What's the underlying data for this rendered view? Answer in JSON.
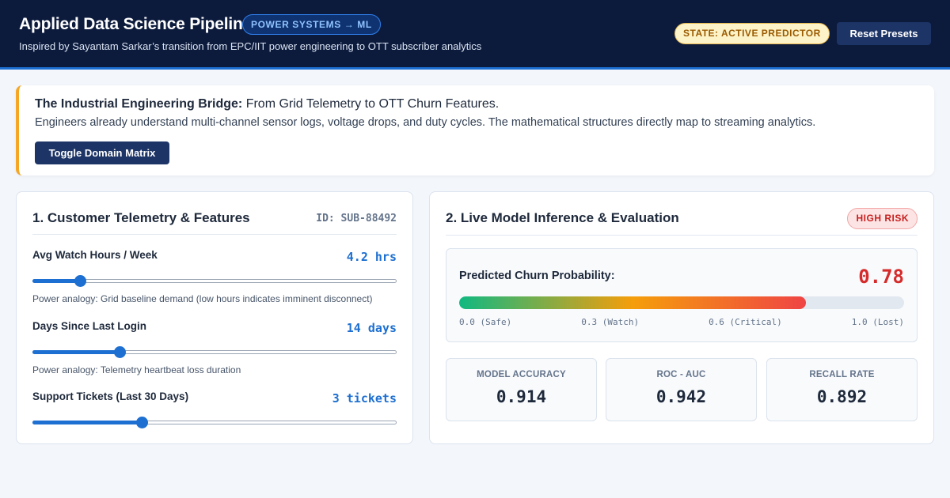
{
  "header": {
    "title": "Applied Data Science Pipeline",
    "badge": "POWER SYSTEMS → ML",
    "subtitle": "Inspired by Sayantam Sarkar’s transition from EPC/IIT power engineering to OTT subscriber analytics",
    "state": "STATE: ACTIVE PREDICTOR",
    "reset_label": "Reset Presets"
  },
  "bridge": {
    "heading_bold": "The Industrial Engineering Bridge:",
    "heading_rest": " From Grid Telemetry to OTT Churn Features.",
    "description": "Engineers already understand multi-channel sensor logs, voltage drops, and duty cycles. The mathematical structures directly map to streaming analytics.",
    "toggle_label": "Toggle Domain Matrix"
  },
  "features_panel": {
    "title": "1. Customer Telemetry & Features",
    "subscriber_id": "ID: SUB-88492",
    "features": [
      {
        "label": "Avg Watch Hours / Week",
        "value_text": "4.2 hrs",
        "slider_fraction": 0.13,
        "analogy": "Power analogy: Grid baseline demand (low hours indicates imminent disconnect)"
      },
      {
        "label": "Days Since Last Login",
        "value_text": "14 days",
        "slider_fraction": 0.24,
        "analogy": "Power analogy: Telemetry heartbeat loss duration"
      },
      {
        "label": "Support Tickets (Last 30 Days)",
        "value_text": "3 tickets",
        "slider_fraction": 0.3,
        "analogy": ""
      }
    ]
  },
  "inference_panel": {
    "title": "2. Live Model Inference & Evaluation",
    "risk_badge": "HIGH RISK",
    "probability_label": "Predicted Churn Probability:",
    "probability_value": "0.78",
    "probability_fraction": 0.78,
    "scale": [
      "0.0 (Safe)",
      "0.3 (Watch)",
      "0.6 (Critical)",
      "1.0 (Lost)"
    ],
    "metrics": [
      {
        "label": "MODEL ACCURACY",
        "value": "0.914"
      },
      {
        "label": "ROC - AUC",
        "value": "0.942"
      },
      {
        "label": "RECALL RATE",
        "value": "0.892"
      }
    ]
  },
  "colors": {
    "header_bg": "#0c1a3c",
    "accent_blue": "#1d6fd1",
    "risk_red": "#d62b2b",
    "bridge_accent": "#f5a623",
    "state_bg": "#fdf3c8"
  }
}
